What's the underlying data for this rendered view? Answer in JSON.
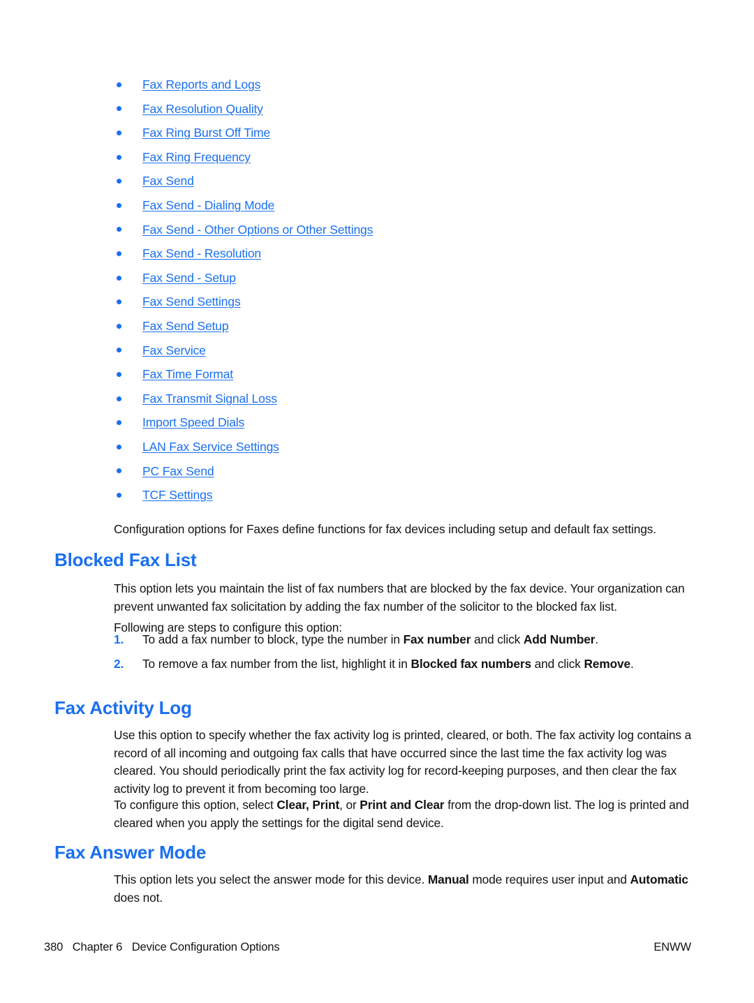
{
  "page": {
    "number": "380",
    "chapter": "Chapter 6",
    "chapter_title": "Device Configuration Options",
    "locale_code": "ENWW",
    "accent_color": "#1a6ff0",
    "text_color": "#131313"
  },
  "link_list": {
    "items": [
      {
        "label": "Fax Reports and Logs"
      },
      {
        "label": "Fax Resolution Quality"
      },
      {
        "label": "Fax Ring Burst Off Time"
      },
      {
        "label": "Fax Ring Frequency"
      },
      {
        "label": "Fax Send"
      },
      {
        "label": "Fax Send - Dialing Mode"
      },
      {
        "label": "Fax Send - Other Options or Other Settings"
      },
      {
        "label": "Fax Send - Resolution"
      },
      {
        "label": "Fax Send - Setup"
      },
      {
        "label": "Fax Send Settings"
      },
      {
        "label": "Fax Send Setup"
      },
      {
        "label": "Fax Service"
      },
      {
        "label": "Fax Time Format"
      },
      {
        "label": "Fax Transmit Signal Loss"
      },
      {
        "label": "Import Speed Dials"
      },
      {
        "label": "LAN Fax Service Settings"
      },
      {
        "label": "PC Fax Send"
      },
      {
        "label": "TCF Settings"
      }
    ]
  },
  "intro": {
    "paragraph": "Configuration options for Faxes define functions for fax devices including setup and default fax settings."
  },
  "blocked_fax_list": {
    "heading": "Blocked Fax List",
    "paragraph": "This option lets you maintain the list of fax numbers that are blocked by the fax device. Your organization can prevent unwanted fax solicitation by adding the fax number of the solicitor to the blocked fax list.",
    "steps_intro": "Following are steps to configure this option:",
    "steps": [
      {
        "number": "1.",
        "text_before": "To add a fax number to block, type the number in ",
        "bold_1": "Fax number",
        "text_middle": " and click ",
        "bold_2": "Add Number",
        "text_after": "."
      },
      {
        "number": "2.",
        "text_before": "To remove a fax number from the list, highlight it in ",
        "bold_1": "Blocked fax numbers",
        "text_middle": " and click ",
        "bold_2": "Remove",
        "text_after": "."
      }
    ]
  },
  "fax_activity_log": {
    "heading": "Fax Activity Log",
    "paragraph_1": "Use this option to specify whether the fax activity log is printed, cleared, or both. The fax activity log contains a record of all incoming and outgoing fax calls that have occurred since the last time the fax activity log was cleared. You should periodically print the fax activity log for record-keeping purposes, and then clear the fax activity log to prevent it from becoming too large.",
    "paragraph_2": {
      "text_before": "To configure this option, select ",
      "bold_options": "Clear, Print",
      "text_middle": ", or ",
      "bold_option_3": "Print and Clear",
      "text_after": " from the drop-down list. The log is printed and cleared when you apply the settings for the digital send device."
    }
  },
  "fax_answer_mode": {
    "heading": "Fax Answer Mode",
    "paragraph": {
      "text_before": "This option lets you select the answer mode for this device. ",
      "bold_1": "Manual",
      "text_middle": " mode requires user input and ",
      "bold_2": "Automatic",
      "text_after": " does not."
    }
  }
}
